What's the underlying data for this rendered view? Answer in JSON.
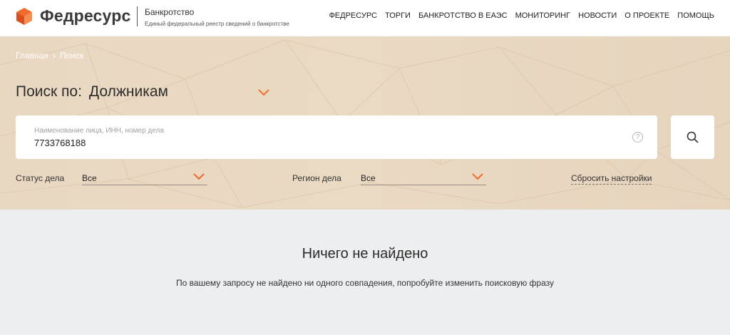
{
  "header": {
    "logo_text": "Федресурс",
    "section_title": "Банкротство",
    "section_desc": "Единый федеральный реестр сведений о банкротстве",
    "nav": [
      {
        "label": "ФЕДРЕСУРС"
      },
      {
        "label": "ТОРГИ"
      },
      {
        "label": "БАНКРОТСТВО В ЕАЭС"
      },
      {
        "label": "МОНИТОРИНГ"
      },
      {
        "label": "НОВОСТИ"
      },
      {
        "label": "О ПРОЕКТЕ"
      },
      {
        "label": "ПОМОЩЬ"
      }
    ]
  },
  "breadcrumb": {
    "home": "Главная",
    "separator": "›",
    "current": "Поиск"
  },
  "search": {
    "by_label": "Поиск по:",
    "mode": "Должникам",
    "placeholder": "Наименование лица, ИНН, номер дела",
    "value": "7733768188",
    "help": "?"
  },
  "filters": {
    "status_label": "Статус дела",
    "status_value": "Все",
    "region_label": "Регион дела",
    "region_value": "Все",
    "reset_label": "Сбросить настройки"
  },
  "results": {
    "empty_title": "Ничего не найдено",
    "empty_desc": "По вашему запросу не найдено ни одного совпадения, попробуйте изменить поисковую фразу"
  },
  "colors": {
    "accent": "#f26b2a",
    "hero_bg": "#e9d8c1",
    "page_bg": "#eceef0"
  },
  "icons": {
    "logo": "fedresurs-logo-icon",
    "chevron": "chevron-down-icon",
    "search": "search-icon",
    "help": "question-circle-icon"
  }
}
